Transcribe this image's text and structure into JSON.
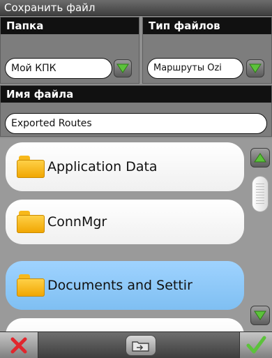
{
  "window": {
    "title": "Сохранить файл"
  },
  "folder": {
    "label": "Папка",
    "value": "Мой КПК"
  },
  "filetype": {
    "label": "Тип файлов",
    "value": "Маршруты Ozi"
  },
  "filename": {
    "label": "Имя файла",
    "value": "Exported Routes"
  },
  "list": {
    "items": [
      {
        "name": "Application Data",
        "selected": false
      },
      {
        "name": "ConnMgr",
        "selected": false
      },
      {
        "name": "Documents and Settir",
        "selected": true
      }
    ]
  },
  "icons": {
    "dropdown": "green-down-triangle-icon",
    "scroll_up": "green-up-triangle-icon",
    "scroll_down": "green-down-triangle-icon",
    "cancel": "red-x-icon",
    "ok": "green-checkmark-icon",
    "new_folder": "new-folder-icon"
  },
  "colors": {
    "accent_green": "#5cc23b",
    "selection_blue": "#8ccaf8",
    "cancel_red": "#e1262d"
  }
}
